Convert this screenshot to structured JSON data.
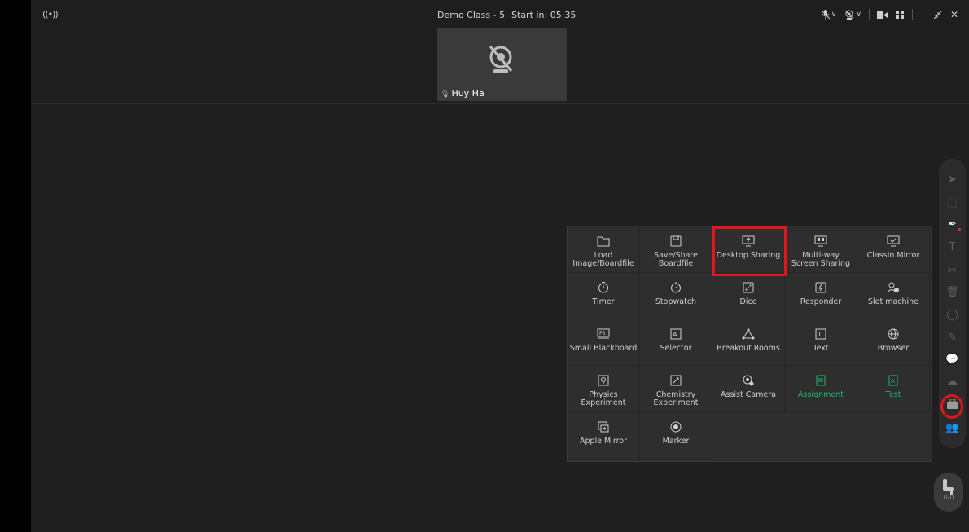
{
  "topbar": {
    "broadcast_icon": "broadcast-icon",
    "class_name": "Demo Class - 5",
    "start_label": "Start in: 05:35"
  },
  "video": {
    "participant_name": "Huy Ha"
  },
  "tools_panel": {
    "items": [
      {
        "label": "Load\nImage/Boardfile",
        "icon": "folder-icon"
      },
      {
        "label": "Save/Share\nBoardfile",
        "icon": "save-icon"
      },
      {
        "label": "Desktop Sharing",
        "icon": "desktop-share-icon"
      },
      {
        "label": "Multi-way\nScreen Sharing",
        "icon": "multi-screen-icon"
      },
      {
        "label": "ClassIn Mirror",
        "icon": "mirror-icon"
      },
      {
        "label": "Timer",
        "icon": "timer-icon"
      },
      {
        "label": "Stopwatch",
        "icon": "stopwatch-icon"
      },
      {
        "label": "Dice",
        "icon": "dice-icon"
      },
      {
        "label": "Responder",
        "icon": "responder-icon"
      },
      {
        "label": "Slot machine",
        "icon": "slot-machine-icon"
      },
      {
        "label": "Small Blackboard",
        "icon": "blackboard-icon"
      },
      {
        "label": "Selector",
        "icon": "selector-icon"
      },
      {
        "label": "Breakout Rooms",
        "icon": "breakout-icon"
      },
      {
        "label": "Text",
        "icon": "text-icon"
      },
      {
        "label": "Browser",
        "icon": "globe-icon"
      },
      {
        "label": "Physics\nExperiment",
        "icon": "physics-icon"
      },
      {
        "label": "Chemistry\nExperiment",
        "icon": "chemistry-icon"
      },
      {
        "label": "Assist Camera",
        "icon": "assist-camera-icon"
      },
      {
        "label": "Assignment",
        "icon": "assignment-icon"
      },
      {
        "label": "Test",
        "icon": "test-icon"
      },
      {
        "label": "Apple Mirror",
        "icon": "apple-mirror-icon"
      },
      {
        "label": "Marker",
        "icon": "marker-icon"
      }
    ]
  },
  "seat": {
    "count": "0/0"
  },
  "colors": {
    "highlight": "#e0161e",
    "accent_green": "#22b573"
  }
}
